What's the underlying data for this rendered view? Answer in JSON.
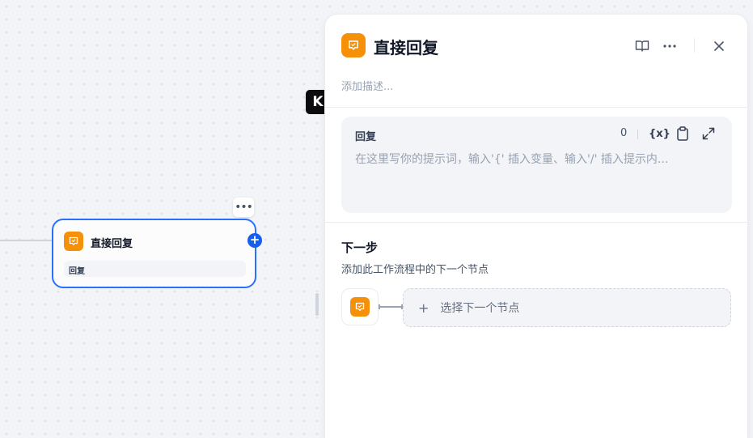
{
  "canvas": {
    "node": {
      "title": "直接回复",
      "chip": "回复",
      "add_symbol": "+",
      "more_symbol": "•••"
    },
    "logo_text": "K"
  },
  "panel": {
    "title": "直接回复",
    "description_placeholder": "添加描述...",
    "icons": [
      "book-icon",
      "more-icon",
      "close-icon"
    ],
    "reply": {
      "label": "回复",
      "count": "0",
      "var_button": "{x}",
      "placeholder": "在这里写你的提示词，输入'{' 插入变量、输入'/' 插入提示内..."
    },
    "next_step": {
      "title": "下一步",
      "description": "添加此工作流程中的下一个节点",
      "select_plus": "+",
      "select_label": "选择下一个节点"
    }
  },
  "colors": {
    "accent": "#155eef",
    "node_icon": "#f79009"
  }
}
